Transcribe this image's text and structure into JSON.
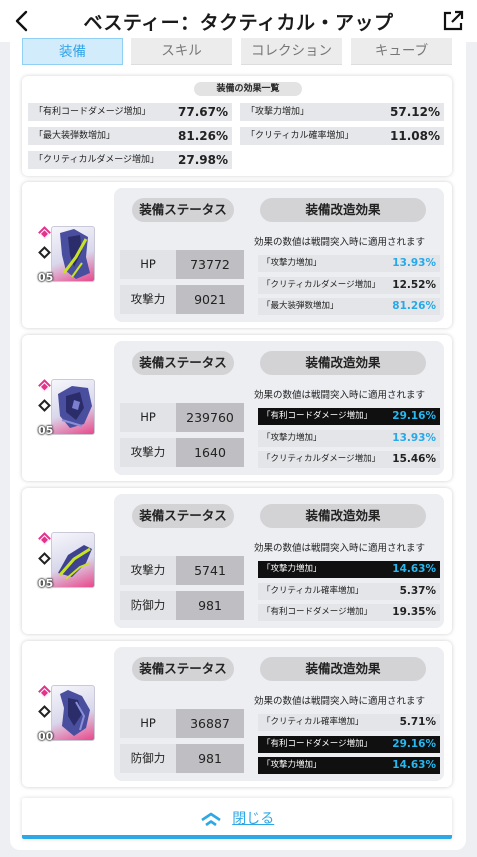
{
  "header": {
    "title": "ベスティー：タクティカル・アップ"
  },
  "tabs": [
    {
      "label": "装備",
      "active": true
    },
    {
      "label": "スキル",
      "active": false
    },
    {
      "label": "コレクション",
      "active": false
    },
    {
      "label": "キューブ",
      "active": false
    }
  ],
  "summary": {
    "title": "装備の効果一覧",
    "items": [
      {
        "label": "「有利コードダメージ増加」",
        "value": "77.67%"
      },
      {
        "label": "「攻撃力増加」",
        "value": "57.12%"
      },
      {
        "label": "「最大装弾数増加」",
        "value": "81.26%"
      },
      {
        "label": "「クリティカル確率増加」",
        "value": "11.08%"
      },
      {
        "label": "「クリティカルダメージ増加」",
        "value": "27.98%"
      }
    ]
  },
  "card_common": {
    "stat_title": "装備ステータス",
    "mod_title": "装備改造効果",
    "mod_note": "効果の数値は戦闘突入時に適用されます"
  },
  "cards": [
    {
      "rank": "05",
      "stats": [
        {
          "label": "HP",
          "value": "73772"
        },
        {
          "label": "攻撃力",
          "value": "9021"
        }
      ],
      "mods": [
        {
          "label": "「攻撃力増加」",
          "value": "13.93%",
          "highlight": "blue"
        },
        {
          "label": "「クリティカルダメージ増加」",
          "value": "12.52%",
          "highlight": "none"
        },
        {
          "label": "「最大装弾数増加」",
          "value": "81.26%",
          "highlight": "blue"
        }
      ]
    },
    {
      "rank": "05",
      "stats": [
        {
          "label": "HP",
          "value": "239760"
        },
        {
          "label": "攻撃力",
          "value": "1640"
        }
      ],
      "mods": [
        {
          "label": "「有利コードダメージ増加」",
          "value": "29.16%",
          "highlight": "dark"
        },
        {
          "label": "「攻撃力増加」",
          "value": "13.93%",
          "highlight": "blue"
        },
        {
          "label": "「クリティカルダメージ増加」",
          "value": "15.46%",
          "highlight": "none"
        }
      ]
    },
    {
      "rank": "05",
      "stats": [
        {
          "label": "攻撃力",
          "value": "5741"
        },
        {
          "label": "防御力",
          "value": "981"
        }
      ],
      "mods": [
        {
          "label": "「攻撃力増加」",
          "value": "14.63%",
          "highlight": "dark"
        },
        {
          "label": "「クリティカル確率増加」",
          "value": "5.37%",
          "highlight": "none"
        },
        {
          "label": "「有利コードダメージ増加」",
          "value": "19.35%",
          "highlight": "none"
        }
      ]
    },
    {
      "rank": "00",
      "stats": [
        {
          "label": "HP",
          "value": "36887"
        },
        {
          "label": "防御力",
          "value": "981"
        }
      ],
      "mods": [
        {
          "label": "「クリティカル確率増加」",
          "value": "5.71%",
          "highlight": "none"
        },
        {
          "label": "「有利コードダメージ増加」",
          "value": "29.16%",
          "highlight": "dark"
        },
        {
          "label": "「攻撃力増加」",
          "value": "14.63%",
          "highlight": "dark"
        }
      ]
    }
  ],
  "close": {
    "label": "閉じる"
  },
  "colors": {
    "accent": "#2ea7e6",
    "highlight_blue": "#26a9e8",
    "rank_pink": "#e2348d"
  },
  "icons": {
    "back": "chevron-left-icon",
    "external": "external-link-icon",
    "close": "double-chevron-up-icon"
  }
}
